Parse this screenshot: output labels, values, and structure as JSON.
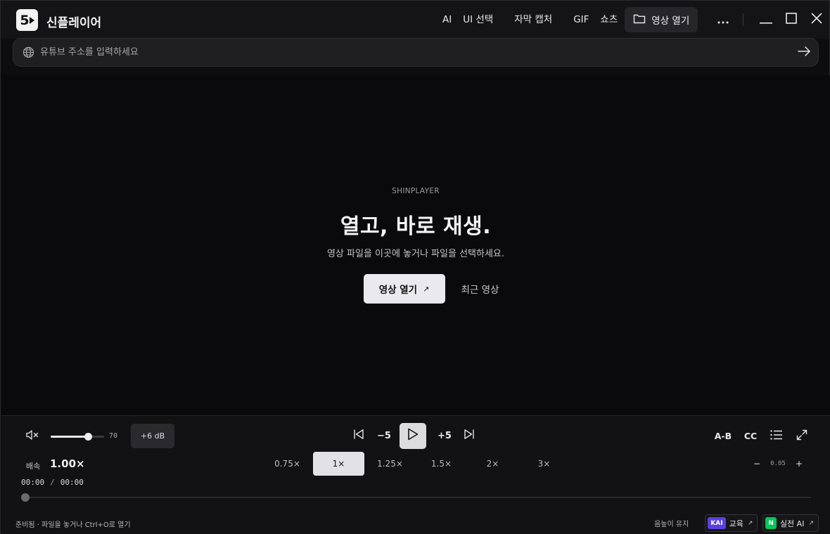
{
  "app": {
    "title": "신플레이어",
    "logo_glyph": "5"
  },
  "top_menu": {
    "items": [
      "AI",
      "UI 선택",
      "자막 캡처",
      "GIF",
      "쇼츠"
    ],
    "open_video": "영상 열기",
    "more_icon": "more-horizontal-icon"
  },
  "url_bar": {
    "placeholder": "유튜브 주소를 입력하세요",
    "value": ""
  },
  "stage": {
    "eyebrow": "SHINPLAYER",
    "headline": "열고, 바로 재생.",
    "subtitle": "영상 파일을 이곳에 놓거나 파일을 선택하세요.",
    "cta_label": "영상 열기",
    "cta_arrow": "↗",
    "recent_label": "최근 영상"
  },
  "controls": {
    "volume": 70,
    "volume_label": "70",
    "boost_label": "+6 dB",
    "skip_back": "−5",
    "skip_forward": "+5",
    "right_labels": {
      "ab": "A-B",
      "cc": "CC"
    },
    "speed_label": "배속",
    "speed_value": "1.00×",
    "speeds": [
      "0.75×",
      "1×",
      "1.25×",
      "1.5×",
      "2×",
      "3×"
    ],
    "active_speed_index": 1,
    "fine_minus": "−",
    "fine_step": "0.05",
    "fine_plus": "+",
    "time_current": "00:00",
    "time_sep": "/",
    "time_total": "00:00",
    "progress": 0
  },
  "footer": {
    "status": "준비됨 · 파일을 놓거나 Ctrl+O로 열기",
    "keep_volume": "음높이 유지",
    "pills": [
      {
        "badge": "KAI",
        "label": "교육",
        "arrow": "↗",
        "color": "#5b3fe0"
      },
      {
        "badge": "N",
        "label": "실전 AI",
        "arrow": "↗",
        "color": "#03c75a"
      }
    ]
  },
  "colors": {
    "background": "#0d0d0f",
    "panel": "#121214",
    "accent_light": "#e9e9ee"
  }
}
